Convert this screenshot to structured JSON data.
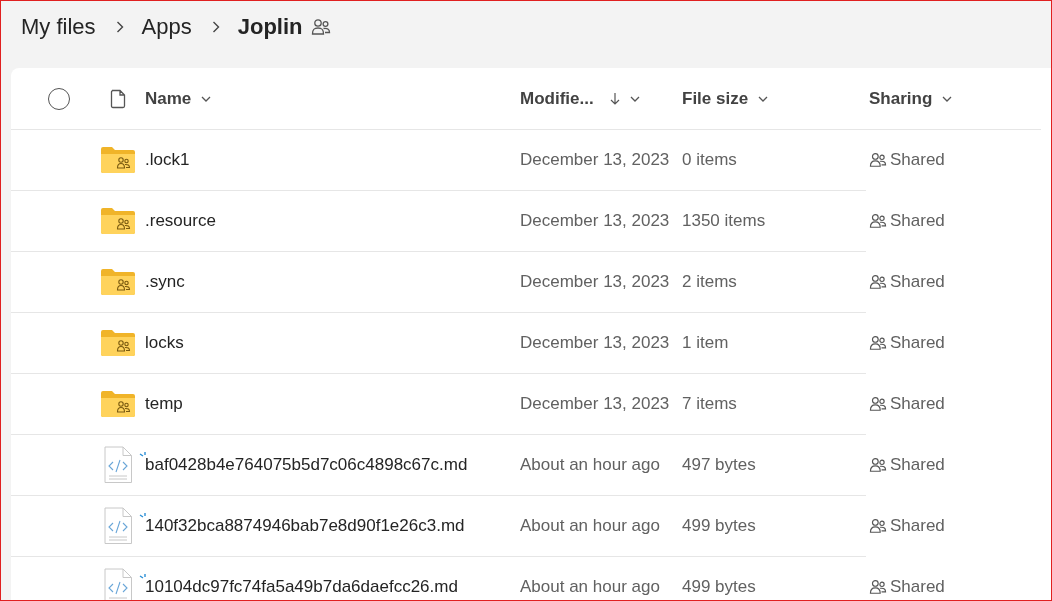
{
  "breadcrumb": [
    {
      "label": "My files",
      "current": false
    },
    {
      "label": "Apps",
      "current": false
    },
    {
      "label": "Joplin",
      "current": true
    }
  ],
  "table": {
    "select_all": {
      "checked": false
    },
    "columns": [
      {
        "label": "Name",
        "sorted": false
      },
      {
        "label": "Modifie...",
        "sorted": true
      },
      {
        "label": "File size",
        "sorted": false
      },
      {
        "label": "Sharing",
        "sorted": false
      }
    ],
    "rows": [
      {
        "kind": "folder",
        "name": ".lock1",
        "new": false,
        "modified": "December 13, 2023",
        "size": "0 items",
        "sharing": "Shared"
      },
      {
        "kind": "folder",
        "name": ".resource",
        "new": false,
        "modified": "December 13, 2023",
        "size": "1350 items",
        "sharing": "Shared"
      },
      {
        "kind": "folder",
        "name": ".sync",
        "new": false,
        "modified": "December 13, 2023",
        "size": "2 items",
        "sharing": "Shared"
      },
      {
        "kind": "folder",
        "name": "locks",
        "new": false,
        "modified": "December 13, 2023",
        "size": "1 item",
        "sharing": "Shared"
      },
      {
        "kind": "folder",
        "name": "temp",
        "new": false,
        "modified": "December 13, 2023",
        "size": "7 items",
        "sharing": "Shared"
      },
      {
        "kind": "code-file",
        "name": "baf0428b4e764075b5d7c06c4898c67c.md",
        "new": true,
        "modified": "About an hour ago",
        "size": "497 bytes",
        "sharing": "Shared"
      },
      {
        "kind": "code-file",
        "name": "140f32bca8874946bab7e8d90f1e26c3.md",
        "new": true,
        "modified": "About an hour ago",
        "size": "499 bytes",
        "sharing": "Shared"
      },
      {
        "kind": "code-file",
        "name": "10104dc97fc74fa5a49b7da6daefcc26.md",
        "new": true,
        "modified": "About an hour ago",
        "size": "499 bytes",
        "sharing": "Shared"
      }
    ]
  }
}
